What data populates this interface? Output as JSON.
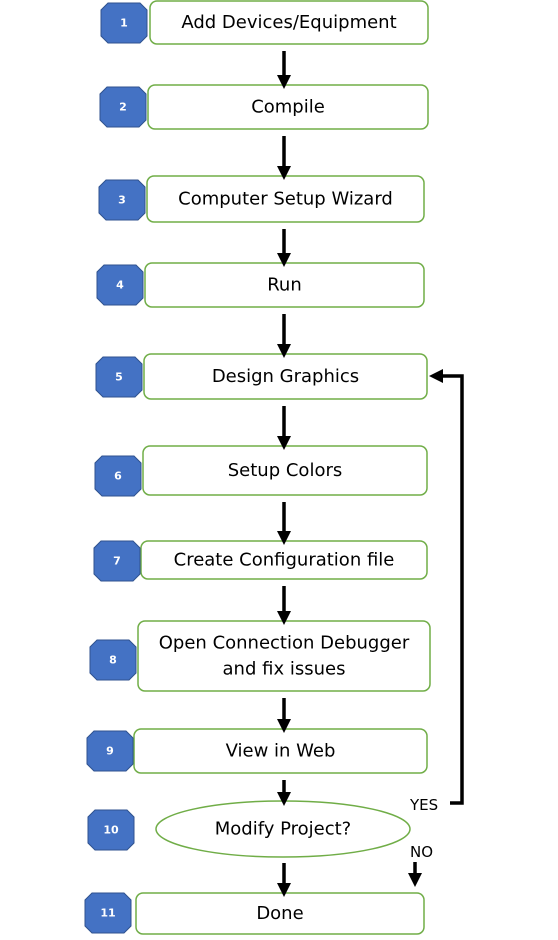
{
  "colors": {
    "badge": "#4472C4",
    "box_border": "#70AD47",
    "arrow": "#000000"
  },
  "steps": [
    {
      "number": "1",
      "label": "Add Devices/Equipment"
    },
    {
      "number": "2",
      "label": "Compile"
    },
    {
      "number": "3",
      "label": "Computer Setup Wizard"
    },
    {
      "number": "4",
      "label": "Run"
    },
    {
      "number": "5",
      "label": "Design Graphics"
    },
    {
      "number": "6",
      "label": "Setup Colors"
    },
    {
      "number": "7",
      "label": "Create Configuration file"
    },
    {
      "number": "8",
      "label": "Open Connection Debugger",
      "label2": "and fix issues"
    },
    {
      "number": "9",
      "label": "View in Web"
    },
    {
      "number": "10",
      "label": "Modify Project?",
      "shape": "decision"
    },
    {
      "number": "11",
      "label": "Done"
    }
  ],
  "branches": {
    "yes": "YES",
    "no": "NO"
  }
}
